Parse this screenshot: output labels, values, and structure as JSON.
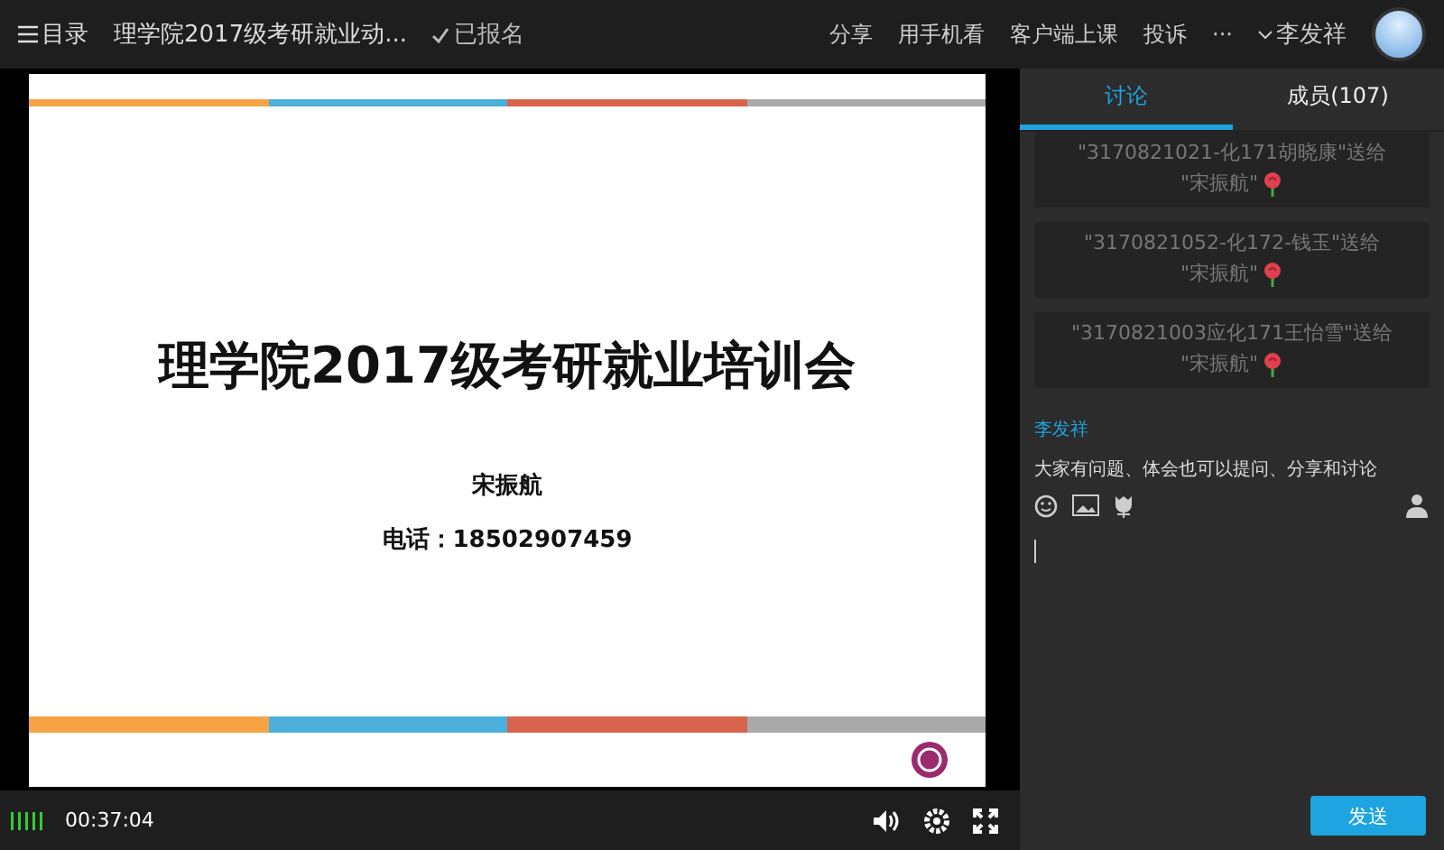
{
  "topbar": {
    "menu_label": "目录",
    "course_title": "理学院2017级考研就业动...",
    "status": "已报名",
    "actions": [
      "分享",
      "用手机看",
      "客户端上课",
      "投诉",
      "···"
    ],
    "user_name": "李发祥"
  },
  "slide": {
    "title": "理学院2017级考研就业培训会",
    "speaker": "宋振航",
    "phone": "电话：18502907459"
  },
  "player": {
    "time": "00:37:04"
  },
  "tabs": [
    {
      "label": "讨论",
      "selected": true
    },
    {
      "label": "成员(107)",
      "selected": false
    }
  ],
  "gifts": [
    {
      "line1": "\"3170821021-化171胡晓康\"送给",
      "line2": "\"宋振航\""
    },
    {
      "line1": "\"3170821052-化172-钱玉\"送给",
      "line2": "\"宋振航\""
    },
    {
      "line1": "\"3170821003应化171王怡雪\"送给",
      "line2": "\"宋振航\""
    }
  ],
  "message": {
    "author": "李发祥",
    "text": "大家有问题、体会也可以提问、分享和讨论"
  },
  "send_button": "发送"
}
